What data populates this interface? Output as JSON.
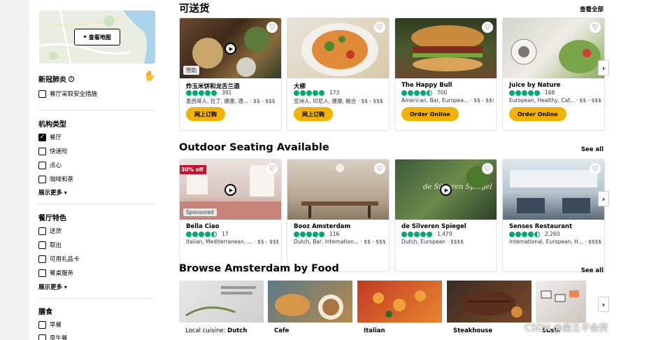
{
  "sidebar": {
    "map_button": "查看地图",
    "covid": {
      "title": "新冠肺炎",
      "info_icon": "i",
      "option": "餐厅采取安全措施"
    },
    "establishment": {
      "title": "机构类型",
      "options": [
        "餐厅",
        "快速咬",
        "点心",
        "咖啡和茶"
      ],
      "more": "展示更多"
    },
    "features": {
      "title": "餐厅特色",
      "options": [
        "送货",
        "取出",
        "可用礼品卡",
        "餐桌服务"
      ],
      "more": "展示更多"
    },
    "meals": {
      "title": "膳食",
      "options": [
        "早餐",
        "早午餐"
      ]
    }
  },
  "delivery": {
    "title": "可送货",
    "see_all": "查看全部",
    "cards": [
      {
        "name": "炸玉米饼和龙舌兰酒",
        "reviews": "391",
        "meta": "墨西哥人, 拉丁, 健康, 酒... · $$ - $$$",
        "button": "网上订购",
        "badge": "赞助"
      },
      {
        "name": "大柳",
        "reviews": "173",
        "meta": "亚洲人, 印尼人, 健康, 融合 · $$ - $$$",
        "button": "网上订购"
      },
      {
        "name": "The Happy Bull",
        "reviews": "700",
        "meta": "American, Bar, Europea... · $$ - $$$",
        "button": "Order Online"
      },
      {
        "name": "Juice by Nature",
        "reviews": "168",
        "meta": "European, Healthy, Caf... · $$ - $$$",
        "button": "Order Online"
      }
    ]
  },
  "outdoor": {
    "title": "Outdoor Seating Available",
    "see_all": "See all",
    "cards": [
      {
        "name": "Bella Ciao",
        "reviews": "17",
        "meta": "Italian, Mediterranean, ... · $$ - $$$",
        "badge": "Sponsored",
        "promo": "30% off"
      },
      {
        "name": "Booz Amsterdam",
        "reviews": "116",
        "meta": "Dutch, Bar, Internation... · $$ - $$$"
      },
      {
        "name": "de Silveren Spiegel",
        "reviews": "1,479",
        "meta": "Dutch, European · $$$$",
        "sign_text": "de Silveren Spiegel"
      },
      {
        "name": "Senses Restaurant",
        "reviews": "2,260",
        "meta": "International, European, H... · $$$$"
      }
    ]
  },
  "browse": {
    "title": "Browse Amsterdam by Food",
    "see_all": "See all",
    "items": [
      {
        "prefix": "Local cuisine: ",
        "label": "Dutch"
      },
      {
        "prefix": "",
        "label": "Cafe"
      },
      {
        "prefix": "",
        "label": "Italian"
      },
      {
        "prefix": "",
        "label": "Steakhouse"
      },
      {
        "prefix": "",
        "label": "Sushi"
      }
    ]
  },
  "watermark": "CSDN @魔王不会哭",
  "icons": {
    "heart": "heart-icon",
    "play": "play-icon",
    "chevron": "chevron-right-icon",
    "pin": "map-pin-icon",
    "hands": "hand-wash-icon"
  },
  "colors": {
    "accent": "#f2b203",
    "rating": "#00aa6c",
    "promo": "#c8102e"
  }
}
